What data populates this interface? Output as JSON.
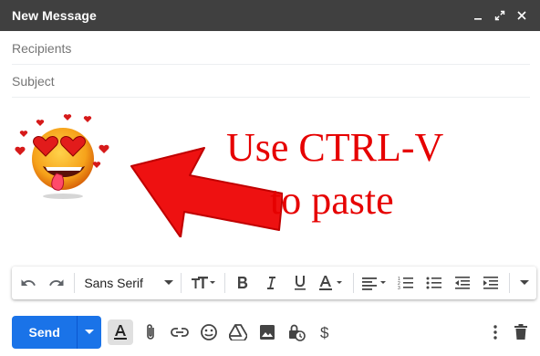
{
  "window": {
    "title": "New Message",
    "controls": [
      "minimize-icon",
      "expand-icon",
      "close-icon"
    ]
  },
  "fields": {
    "recipients_placeholder": "Recipients",
    "subject_placeholder": "Subject"
  },
  "body": {
    "annotation_line1": "Use CTRL-V",
    "annotation_line2": "to paste",
    "emoji": "love-struck-emoji",
    "accent_color": "#e60000"
  },
  "format_toolbar": {
    "font_family": "Sans Serif",
    "items": [
      "undo-icon",
      "redo-icon",
      "font-family-select",
      "font-size-icon",
      "bold-icon",
      "italic-icon",
      "underline-icon",
      "text-color-icon",
      "align-icon",
      "numbered-list-icon",
      "bulleted-list-icon",
      "indent-less-icon",
      "indent-more-icon",
      "more-formatting-icon"
    ]
  },
  "bottom_bar": {
    "send_label": "Send",
    "send_color": "#1a73e8",
    "items": [
      "formatting-options-icon",
      "attach-icon",
      "link-icon",
      "emoji-icon",
      "drive-icon",
      "photo-icon",
      "confidential-icon",
      "money-icon",
      "more-options-icon",
      "discard-icon"
    ]
  }
}
